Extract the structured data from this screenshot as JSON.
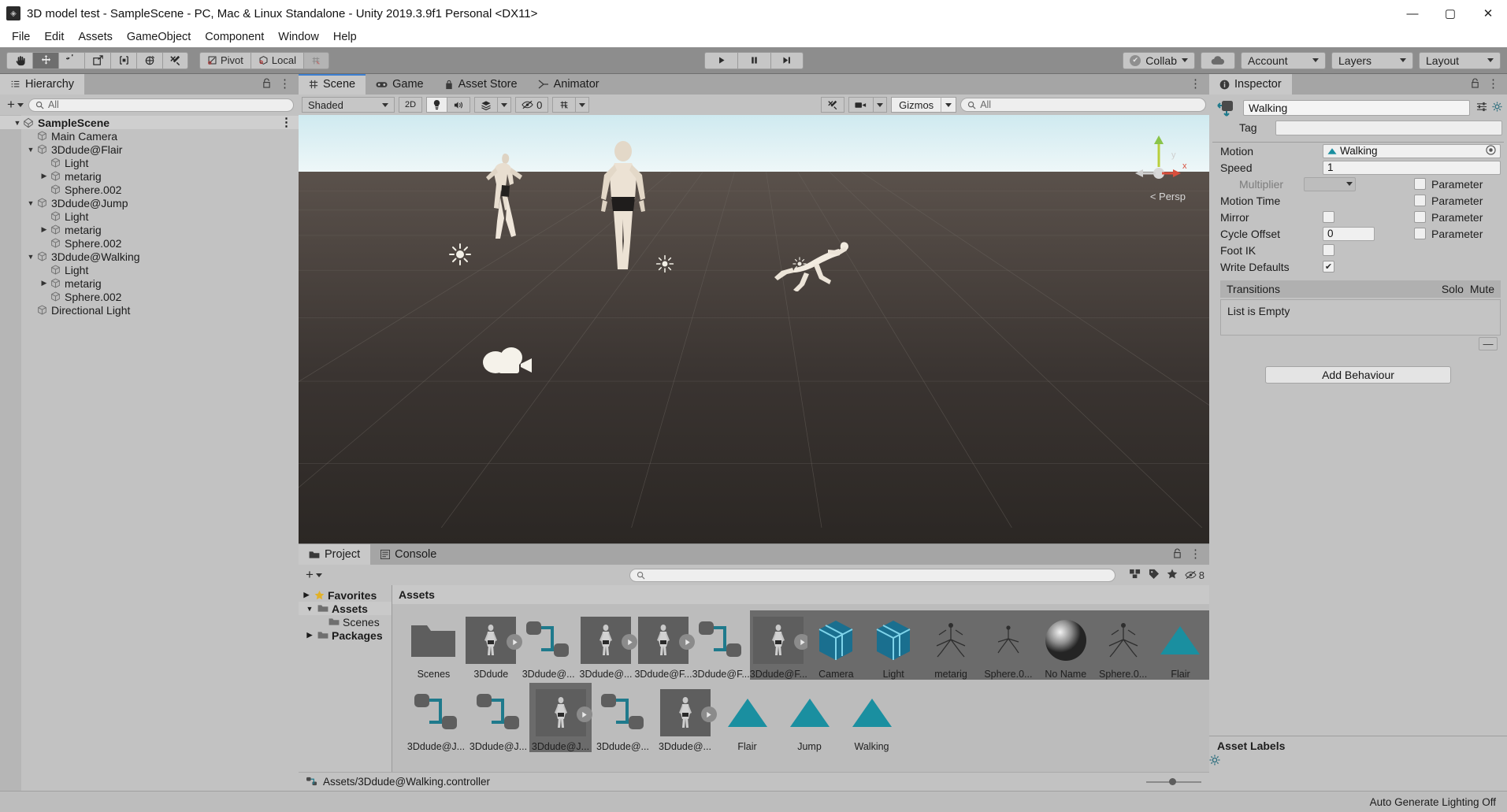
{
  "window": {
    "title": "3D model test - SampleScene - PC, Mac & Linux Standalone - Unity 2019.3.9f1 Personal <DX11>",
    "app_icon": "unity-icon",
    "minimize": "—",
    "maximize": "▢",
    "close": "✕"
  },
  "menu": {
    "items": [
      "File",
      "Edit",
      "Assets",
      "GameObject",
      "Component",
      "Window",
      "Help"
    ]
  },
  "toolbar": {
    "tools": [
      {
        "name": "hand-tool",
        "glyph": "✋",
        "active": false
      },
      {
        "name": "move-tool",
        "glyph": "✥",
        "active": true
      },
      {
        "name": "rotate-tool",
        "glyph": "↺",
        "active": false
      },
      {
        "name": "scale-tool",
        "glyph": "⤢",
        "active": false
      },
      {
        "name": "rect-tool",
        "glyph": "⬓",
        "active": false
      },
      {
        "name": "transform-tool",
        "glyph": "✦",
        "active": false
      },
      {
        "name": "custom-tool",
        "glyph": "✂",
        "active": false
      }
    ],
    "pivot_label": "Pivot",
    "local_label": "Local",
    "grid_snap_glyph": "▦",
    "play": "▶",
    "pause": "❚❚",
    "step": "▶|",
    "collab_label": "Collab",
    "cloud_glyph": "☁",
    "account_label": "Account",
    "layers_label": "Layers",
    "layout_label": "Layout"
  },
  "hierarchy": {
    "tab_label": "Hierarchy",
    "search_placeholder": "All",
    "rows": [
      {
        "label": "SampleScene",
        "depth": 0,
        "tri": "▼",
        "icon": "scene-icon",
        "root": true
      },
      {
        "label": "Main Camera",
        "depth": 1,
        "tri": "",
        "icon": "cube-icon"
      },
      {
        "label": "3Ddude@Flair",
        "depth": 1,
        "tri": "▼",
        "icon": "cube-icon"
      },
      {
        "label": "Light",
        "depth": 2,
        "tri": "",
        "icon": "cube-icon"
      },
      {
        "label": "metarig",
        "depth": 2,
        "tri": "▶",
        "icon": "cube-icon"
      },
      {
        "label": "Sphere.002",
        "depth": 2,
        "tri": "",
        "icon": "cube-icon"
      },
      {
        "label": "3Ddude@Jump",
        "depth": 1,
        "tri": "▼",
        "icon": "cube-icon"
      },
      {
        "label": "Light",
        "depth": 2,
        "tri": "",
        "icon": "cube-icon"
      },
      {
        "label": "metarig",
        "depth": 2,
        "tri": "▶",
        "icon": "cube-icon"
      },
      {
        "label": "Sphere.002",
        "depth": 2,
        "tri": "",
        "icon": "cube-icon"
      },
      {
        "label": "3Ddude@Walking",
        "depth": 1,
        "tri": "▼",
        "icon": "cube-icon"
      },
      {
        "label": "Light",
        "depth": 2,
        "tri": "",
        "icon": "cube-icon"
      },
      {
        "label": "metarig",
        "depth": 2,
        "tri": "▶",
        "icon": "cube-icon"
      },
      {
        "label": "Sphere.002",
        "depth": 2,
        "tri": "",
        "icon": "cube-icon"
      },
      {
        "label": "Directional Light",
        "depth": 1,
        "tri": "",
        "icon": "cube-icon"
      }
    ]
  },
  "scene": {
    "tabs": [
      {
        "label": "Scene",
        "icon": "grid-icon",
        "active": true
      },
      {
        "label": "Game",
        "icon": "gamepad-icon",
        "active": false
      },
      {
        "label": "Asset Store",
        "icon": "store-icon",
        "active": false
      },
      {
        "label": "Animator",
        "icon": "animator-icon",
        "active": false
      }
    ],
    "shading_mode": "Shaded",
    "mode_2d": "2D",
    "lighting_glyph": "💡",
    "audio_glyph": "🔊",
    "effects_glyph": "✦",
    "visibility_count": "0",
    "grid_glyph": "▦",
    "tools_glyph": "✕",
    "camera_glyph": "▣",
    "gizmos_label": "Gizmos",
    "gizmo_search_placeholder": "All",
    "perspective_label": "Persp",
    "axis_x": "x",
    "axis_y": "y"
  },
  "inspector": {
    "tab_label": "Inspector",
    "object_name": "Walking",
    "tag_label": "Tag",
    "tag_value": "",
    "properties": [
      {
        "label": "Motion",
        "value": "Walking",
        "type": "object"
      },
      {
        "label": "Speed",
        "value": "1",
        "type": "text"
      },
      {
        "label": "Multiplier",
        "value": "",
        "type": "dropdown-dim",
        "param": "Parameter",
        "param_checked": false
      },
      {
        "label": "Motion Time",
        "value": "",
        "type": "none",
        "param": "Parameter",
        "param_checked": false
      },
      {
        "label": "Mirror",
        "value": "",
        "type": "checkbox",
        "checked": false,
        "param": "Parameter",
        "param_checked": false
      },
      {
        "label": "Cycle Offset",
        "value": "0",
        "type": "text-small",
        "param": "Parameter",
        "param_checked": false
      },
      {
        "label": "Foot IK",
        "value": "",
        "type": "checkbox",
        "checked": false
      },
      {
        "label": "Write Defaults",
        "value": "",
        "type": "checkbox",
        "checked": true
      }
    ],
    "transitions_label": "Transitions",
    "solo_label": "Solo",
    "mute_label": "Mute",
    "list_empty": "List is Empty",
    "minus_label": "—",
    "add_behaviour_label": "Add Behaviour",
    "asset_labels_title": "Asset Labels"
  },
  "project": {
    "tabs": [
      {
        "label": "Project",
        "icon": "folder-icon",
        "active": true
      },
      {
        "label": "Console",
        "icon": "console-icon",
        "active": false
      }
    ],
    "search_placeholder": "",
    "favorites_label": "Favorites",
    "tree": [
      {
        "label": "Assets",
        "tri": "▼",
        "selected": true,
        "bold": true,
        "depth": 0
      },
      {
        "label": "Scenes",
        "tri": "",
        "selected": false,
        "bold": false,
        "depth": 1
      },
      {
        "label": "Packages",
        "tri": "▶",
        "selected": false,
        "bold": true,
        "depth": 0
      }
    ],
    "breadcrumb": "Assets",
    "status_path": "Assets/3Ddude@Walking.controller",
    "badge_count": "8",
    "rows": [
      [
        {
          "label": "Scenes",
          "kind": "folder"
        },
        {
          "label": "3Ddude",
          "kind": "model"
        },
        {
          "label": "3Ddude@...",
          "kind": "controller"
        },
        {
          "label": "3Ddude@...",
          "kind": "model"
        },
        {
          "label": "3Ddude@F...",
          "kind": "model"
        },
        {
          "label": "3Ddude@F...",
          "kind": "controller"
        },
        {
          "label": "3Ddude@F...",
          "kind": "model",
          "selected": true
        },
        {
          "label": "Camera",
          "kind": "cube-blue",
          "selected": true
        },
        {
          "label": "Light",
          "kind": "cube-blue",
          "selected": true
        },
        {
          "label": "metarig",
          "kind": "mesh",
          "selected": true
        },
        {
          "label": "Sphere.0...",
          "kind": "sphere",
          "selected": true
        },
        {
          "label": "No Name",
          "kind": "sphere-big",
          "selected": true
        },
        {
          "label": "Sphere.0...",
          "kind": "mesh",
          "selected": true
        },
        {
          "label": "Flair",
          "kind": "anim",
          "selected": true
        }
      ],
      [
        {
          "label": "3Ddude@J...",
          "kind": "controller"
        },
        {
          "label": "3Ddude@J...",
          "kind": "controller"
        },
        {
          "label": "3Ddude@J...",
          "kind": "model",
          "highlighted": true
        },
        {
          "label": "3Ddude@...",
          "kind": "controller"
        },
        {
          "label": "3Ddude@...",
          "kind": "model"
        },
        {
          "label": "Flair",
          "kind": "anim"
        },
        {
          "label": "Jump",
          "kind": "anim"
        },
        {
          "label": "Walking",
          "kind": "anim"
        }
      ]
    ]
  },
  "footer": {
    "lighting_status": "Auto Generate Lighting Off"
  },
  "colors": {
    "accent_teal": "#1f7a8c",
    "panel": "#c2c2c2",
    "toolbar": "#8d8d8d",
    "tabbar": "#a5a5a5",
    "selection": "#6b6b6b",
    "blue_tab": "#3d7fd1"
  }
}
